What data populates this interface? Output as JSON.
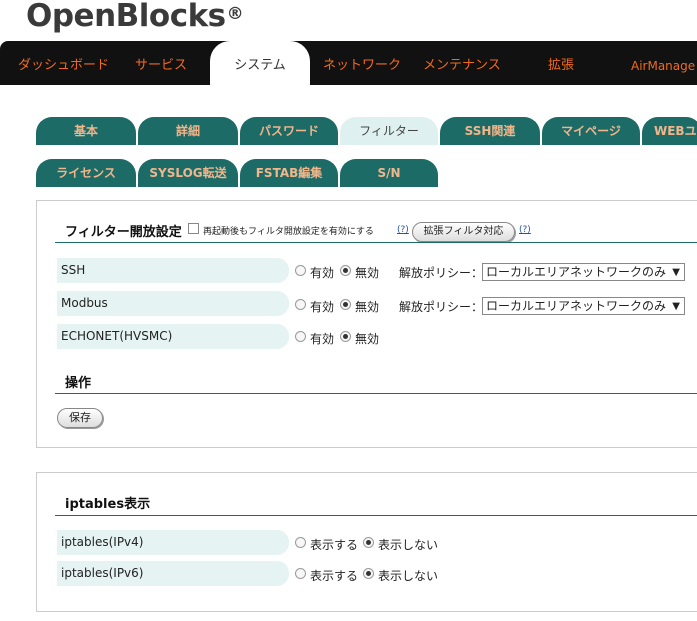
{
  "brand": {
    "name": "OpenBlocks",
    "mark": "®"
  },
  "topnav": [
    {
      "label": "ダッシュボード",
      "active": false
    },
    {
      "label": "サービス",
      "active": false
    },
    {
      "label": "システム",
      "active": true
    },
    {
      "label": "ネットワーク",
      "active": false
    },
    {
      "label": "メンテナンス",
      "active": false
    },
    {
      "label": "拡張",
      "active": false
    },
    {
      "label": "AirManage",
      "active": false
    }
  ],
  "tabs_row1": [
    "基本",
    "詳細",
    "パスワード",
    "フィルター",
    "SSH関連",
    "マイページ",
    "WEBユ"
  ],
  "tabs_row2": [
    "ライセンス",
    "SYSLOG転送",
    "FSTAB編集",
    "S/N"
  ],
  "filter": {
    "title": "フィルター開放設定",
    "checkbox_label": "再起動後もフィルタ開放設定を有効にする",
    "help": "(?)",
    "extend_button": "拡張フィルタ対応",
    "enable_label": "有効",
    "disable_label": "無効",
    "policy_label": "解放ポリシー：",
    "rows": [
      {
        "label": "SSH",
        "state": "無効",
        "policy": "ローカルエリアネットワークのみ"
      },
      {
        "label": "Modbus",
        "state": "無効",
        "policy": "ローカルエリアネットワークのみ"
      },
      {
        "label": "ECHONET(HVSMC)",
        "state": "無効"
      }
    ],
    "ops_title": "操作",
    "save_button": "保存"
  },
  "iptables": {
    "title": "iptables表示",
    "show_label": "表示する",
    "hide_label": "表示しない",
    "rows": [
      {
        "label": "iptables(IPv4)",
        "state": "表示しない"
      },
      {
        "label": "iptables(IPv6)",
        "state": "表示しない"
      }
    ]
  },
  "colors": {
    "accent": "#f26a1b",
    "tab": "#1c6b67",
    "tab_text": "#f3b58a",
    "label_bg": "#e6f3f3"
  }
}
